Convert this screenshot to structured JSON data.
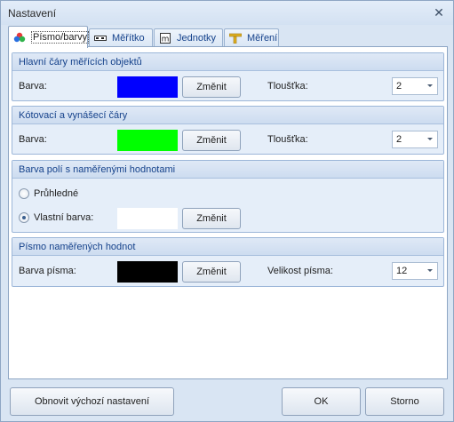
{
  "window": {
    "title": "Nastavení"
  },
  "tabs": [
    {
      "label": "Písmo/barvy",
      "icon": "color-dots-icon",
      "active": true
    },
    {
      "label": "Měřítko",
      "icon": "ruler-scale-icon",
      "active": false
    },
    {
      "label": "Jednotky",
      "icon": "unit-m-icon",
      "active": false
    },
    {
      "label": "Měření",
      "icon": "measure-tool-icon",
      "active": false
    }
  ],
  "groups": {
    "main_lines": {
      "title": "Hlavní čáry měřících objektů",
      "color_label": "Barva:",
      "color": "#0000ff",
      "change_label": "Změnit",
      "thickness_label": "Tloušťka:",
      "thickness_value": "2"
    },
    "dim_lines": {
      "title": "Kótovací a vynášecí čáry",
      "color_label": "Barva:",
      "color": "#00ff00",
      "change_label": "Změnit",
      "thickness_label": "Tloušťka:",
      "thickness_value": "2"
    },
    "field_color": {
      "title": "Barva polí s naměřenými hodnotami",
      "transparent_label": "Průhledné",
      "custom_label": "Vlastní barva:",
      "custom_color": "#ffffff",
      "selected": "custom",
      "change_label": "Změnit"
    },
    "font": {
      "title": "Písmo naměřených hodnot",
      "color_label": "Barva písma:",
      "color": "#000000",
      "change_label": "Změnit",
      "size_label": "Velikost písma:",
      "size_value": "12"
    }
  },
  "footer": {
    "reset_label": "Obnovit výchozí nastavení",
    "ok_label": "OK",
    "cancel_label": "Storno"
  }
}
